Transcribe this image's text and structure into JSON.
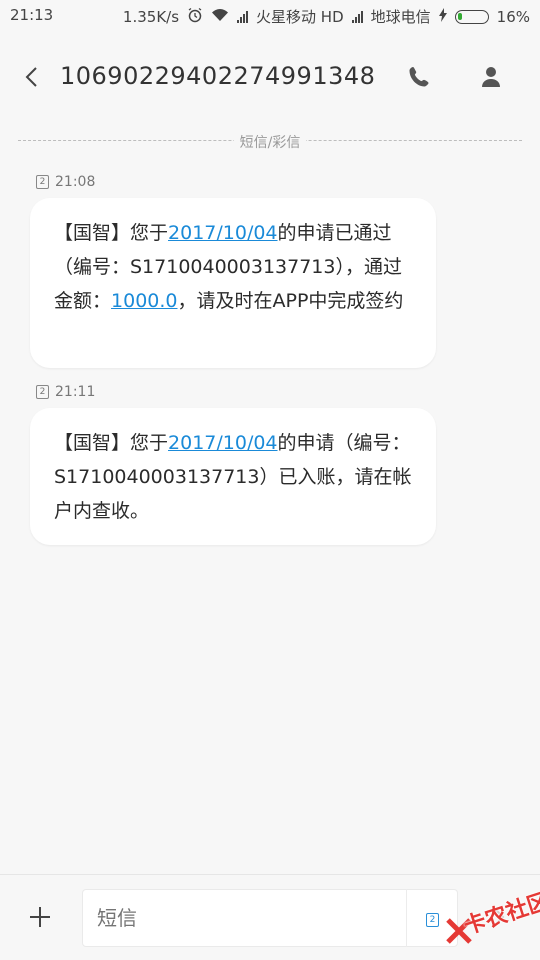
{
  "status_bar": {
    "time": "21:13",
    "net_speed": "1.35K/s",
    "carrier1": "火星移动 HD",
    "carrier2": "地球电信",
    "battery": "16%",
    "battery_level": 0.16
  },
  "header": {
    "title": "10690229402274991348",
    "back_icon": "chevron-left-icon",
    "phone_icon": "phone-icon",
    "contact_icon": "person-icon"
  },
  "divider_label": "短信/彩信",
  "messages": [
    {
      "sim": "2",
      "time": "21:08",
      "parts": [
        "【国智】您于",
        "2017/10/04",
        "的申请已通过（编号：S1710040003137713），通过金额：",
        "1000.0",
        "，请及时在APP中完成签约"
      ]
    },
    {
      "sim": "2",
      "time": "21:11",
      "parts": [
        "【国智】您于",
        "2017/10/04",
        "的申请（编号：S1710040003137713）已入账，请在帐户内查收。"
      ]
    }
  ],
  "composer": {
    "placeholder": "短信",
    "sim": "2"
  },
  "watermark": "卡农社区",
  "colors": {
    "link": "#1a8ad8",
    "background": "#f7f7f7",
    "bubble": "#ffffff",
    "battery_fill": "#33aa33",
    "watermark": "#e53935"
  }
}
